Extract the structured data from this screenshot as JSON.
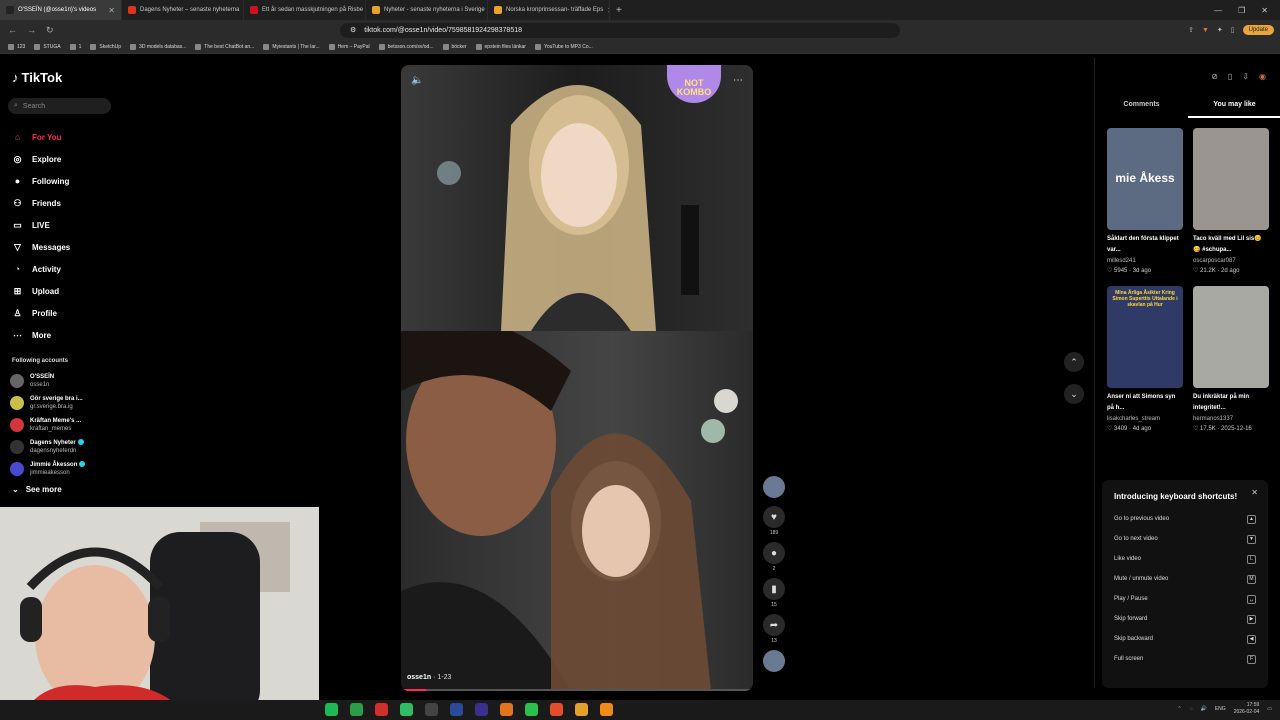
{
  "browser": {
    "tabs": [
      {
        "label": "O'SSEÏN (@osse1n)'s videos",
        "color": "#222",
        "active": true
      },
      {
        "label": "Dagens Nyheter – senaste nyheterna",
        "color": "#d32",
        "active": false
      },
      {
        "label": "Ett år sedan masskjutningen på Risbe",
        "color": "#c12",
        "active": false
      },
      {
        "label": "Nyheter - senaste nyheterna i Sverige",
        "color": "#e9a12b",
        "active": false
      },
      {
        "label": "Norska kronprinsessan- träffade Eps",
        "color": "#e9a12b",
        "active": false
      }
    ],
    "url": "tiktok.com/@osse1n/video/7598581924298378518",
    "update_label": "Update",
    "bookmarks": [
      "123",
      "STUGA",
      "1",
      "SketchUp",
      "3D models databas...",
      "The best ChatBot an...",
      "Myiestants | The lar...",
      "Hem – PayPal",
      "betsson.com/sv/od...",
      "böcker",
      "epstein files länkar",
      "YouTube to MP3 Co..."
    ]
  },
  "tiktok": {
    "logo": "TikTok",
    "search_placeholder": "Search",
    "nav": [
      {
        "label": "For You",
        "icon": "home-icon",
        "glyph": "⌂"
      },
      {
        "label": "Explore",
        "icon": "compass-icon",
        "glyph": "◎"
      },
      {
        "label": "Following",
        "icon": "following-icon",
        "glyph": "●"
      },
      {
        "label": "Friends",
        "icon": "friends-icon",
        "glyph": "⚇"
      },
      {
        "label": "LIVE",
        "icon": "live-icon",
        "glyph": "▭"
      },
      {
        "label": "Messages",
        "icon": "messages-icon",
        "glyph": "▽"
      },
      {
        "label": "Activity",
        "icon": "activity-icon",
        "glyph": "◔"
      },
      {
        "label": "Upload",
        "icon": "upload-icon",
        "glyph": "⊞"
      },
      {
        "label": "Profile",
        "icon": "profile-icon",
        "glyph": "♙"
      },
      {
        "label": "More",
        "icon": "more-icon",
        "glyph": "⋯"
      }
    ],
    "following_title": "Following accounts",
    "accounts": [
      {
        "name": "O'SSEÏN",
        "handle": "osse1n",
        "color": "#666",
        "verified": false
      },
      {
        "name": "Gör sverige bra i...",
        "handle": "gr.sverige.bra.ig",
        "color": "#c9c04a",
        "verified": false
      },
      {
        "name": "Kräftan Meme's ...",
        "handle": "kraftan_memes",
        "color": "#d2353a",
        "verified": false
      },
      {
        "name": "Dagens Nyheter",
        "handle": "dagensnyheterdn",
        "color": "#333",
        "verified": true
      },
      {
        "name": "Jimmie Åkesson",
        "handle": "jimmieakesson",
        "color": "#4a4ad0",
        "verified": true
      }
    ],
    "see_more": "See more",
    "video": {
      "author": "osse1n",
      "date": "1-23",
      "combo_line1": "NOT",
      "combo_line2": "KOMBO",
      "progress": 0.07
    },
    "actions": [
      {
        "icon": "author-avatar-icon",
        "glyph": "",
        "count": ""
      },
      {
        "icon": "heart-icon",
        "glyph": "♥",
        "count": "189"
      },
      {
        "icon": "comment-icon",
        "glyph": "●",
        "count": "2"
      },
      {
        "icon": "bookmark-icon",
        "glyph": "▮",
        "count": "15"
      },
      {
        "icon": "share-icon",
        "glyph": "➦",
        "count": "13"
      }
    ],
    "right_tabs": [
      "Comments",
      "You may like"
    ],
    "recommended": [
      {
        "title": "Såklart den första klippet var...",
        "user": "millesd241",
        "meta": "♡ 5945 · 3d ago",
        "thumb_text": "mie Åkess",
        "bg": "#5d6b82"
      },
      {
        "title": "Taco kväll med Lil sis😊 😋 #schupa...",
        "user": "oscarposcar087",
        "meta": "♡ 21.2K · 2d ago",
        "thumb_text": "",
        "bg": "#9a9590"
      },
      {
        "title": "Anser ni att Simons syn på h...",
        "user": "lisakcharles_stream",
        "meta": "♡ 3409 · 4d ago",
        "thumb_text": "Mina Ärliga Åsikter Kring Simon Superttis Uttalande i skavlan på Hur",
        "bg": "#2f3a66"
      },
      {
        "title": "Du inkräktar på min integritet!...",
        "user": "hermanos1337",
        "meta": "♡ 17.5K · 2025-12-16",
        "thumb_text": "",
        "bg": "#a9a9a4"
      }
    ],
    "keyboard": {
      "title": "Introducing keyboard shortcuts!",
      "rows": [
        {
          "label": "Go to previous video",
          "key": "▲"
        },
        {
          "label": "Go to next video",
          "key": "▼"
        },
        {
          "label": "Like video",
          "key": "L"
        },
        {
          "label": "Mute / unmute video",
          "key": "M"
        },
        {
          "label": "Play / Pause",
          "key": "␣"
        },
        {
          "label": "Skip forward",
          "key": "▶"
        },
        {
          "label": "Skip backward",
          "key": "◀"
        },
        {
          "label": "Full screen",
          "key": "F"
        }
      ]
    }
  },
  "taskbar": {
    "lang": "ENG",
    "time": "17:59",
    "date": "2026-02-04"
  }
}
